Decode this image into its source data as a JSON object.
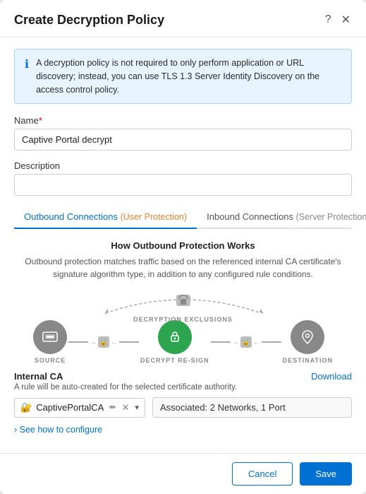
{
  "modal": {
    "title": "Create Decryption Policy",
    "help_icon": "?",
    "close_icon": "✕"
  },
  "info_banner": {
    "text": "A decryption policy is not required to only perform application or URL discovery; instead, you can use TLS 1.3 Server Identity Discovery on the access control policy."
  },
  "form": {
    "name_label": "Name",
    "name_required": "*",
    "name_value": "Captive Portal decrypt",
    "description_label": "Description",
    "description_value": ""
  },
  "tabs": {
    "outbound_label": "Outbound Connections",
    "outbound_sub": "(User Protection)",
    "inbound_label": "Inbound Connections",
    "inbound_sub": "(Server Protection)"
  },
  "outbound_section": {
    "title": "How Outbound Protection Works",
    "description": "Outbound protection matches traffic based on the referenced internal CA certificate's signature algorithm type, in addition to any configured rule conditions.",
    "exclusions_label": "DECRYPTION EXCLUSIONS",
    "source_label": "SOURCE",
    "decrypt_label": "DECRYPT RE-SIGN",
    "destination_label": "DESTINATION"
  },
  "internal_ca": {
    "label": "Internal CA",
    "download_text": "Download",
    "sub_text": "A rule will be auto-created for the selected certificate authority.",
    "ca_name": "CaptivePortalCA",
    "associated_text": "Associated: 2 Networks, 1 Port",
    "see_how_label": "See how to configure"
  },
  "footer": {
    "cancel_label": "Cancel",
    "save_label": "Save"
  }
}
